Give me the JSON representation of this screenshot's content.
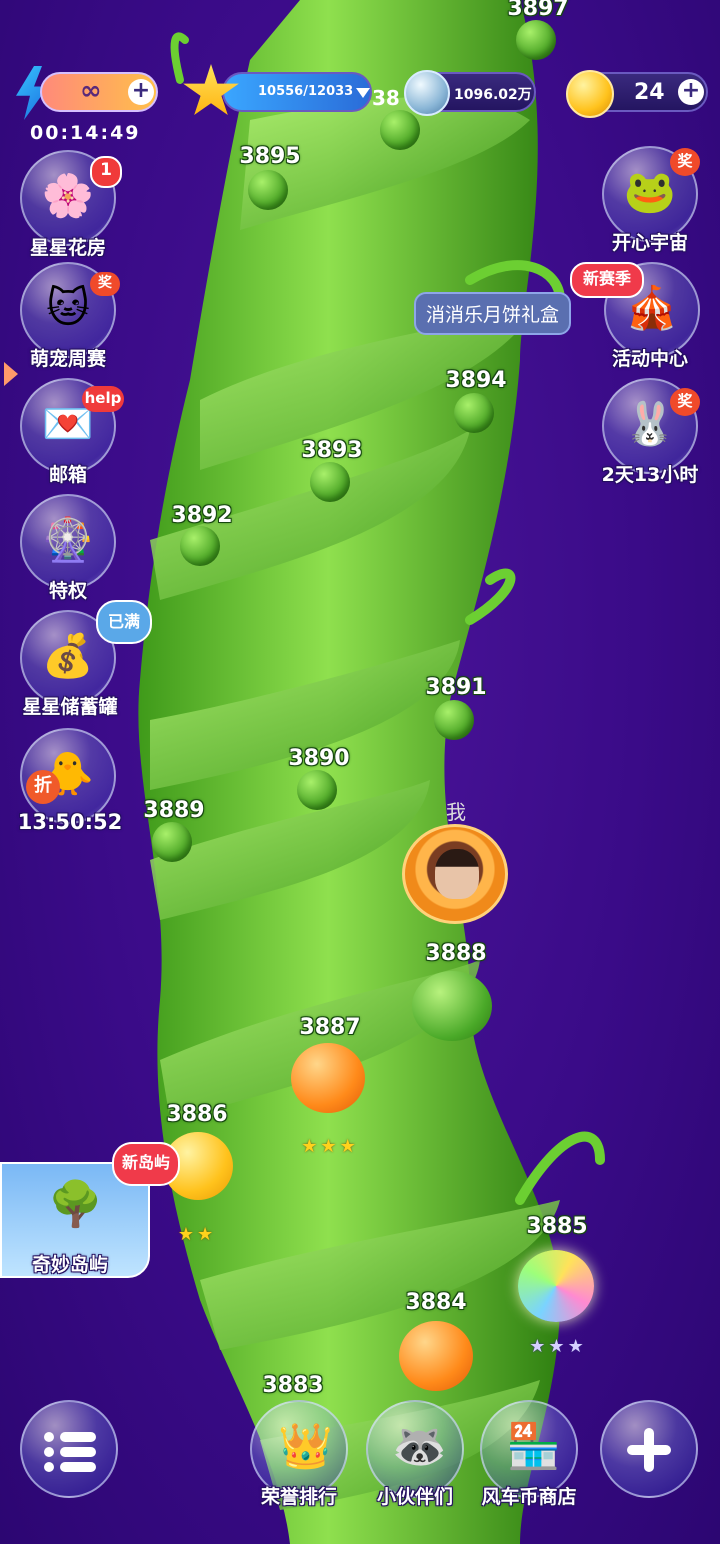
{
  "top_bar": {
    "energy_value": "∞",
    "energy_timer": "00:14:49",
    "stars_progress": "10556/12033",
    "stars_overflow_text": "38",
    "coins_value": "1096.02万",
    "gold_value": "24"
  },
  "side_left": [
    {
      "label": "星星花房",
      "badge": "1",
      "icon": "flower-house-icon"
    },
    {
      "label": "萌宠周赛",
      "badge": "奖",
      "icon": "pet-cat-icon"
    },
    {
      "label": "邮箱",
      "badge": "help",
      "icon": "mail-envelope-icon"
    },
    {
      "label": "特权",
      "badge": "",
      "icon": "privilege-icon"
    },
    {
      "label": "星星储蓄罐",
      "badge": "已满",
      "icon": "piggy-bank-icon"
    },
    {
      "label": "13:50:52",
      "badge": "折",
      "icon": "discount-chick-icon"
    }
  ],
  "side_right": [
    {
      "label": "开心宇宙",
      "badge": "奖",
      "icon": "frog-icon"
    },
    {
      "label": "活动中心",
      "badge": "新赛季",
      "icon": "circus-tent-icon",
      "tooltip": "消消乐月饼礼盒"
    },
    {
      "label": "2天13小时",
      "badge": "奖",
      "icon": "bunny-icon"
    }
  ],
  "levels": [
    {
      "num": "3897"
    },
    {
      "num": "3895"
    },
    {
      "num": "3894"
    },
    {
      "num": "3893"
    },
    {
      "num": "3892"
    },
    {
      "num": "3891"
    },
    {
      "num": "3890"
    },
    {
      "num": "3889"
    },
    {
      "num": "3888"
    },
    {
      "num": "3887",
      "stars": "★★★"
    },
    {
      "num": "3886",
      "stars": "★★"
    },
    {
      "num": "3885",
      "stars": "★★★"
    },
    {
      "num": "3884"
    },
    {
      "num": "3883"
    }
  ],
  "player": {
    "me_label": "我"
  },
  "island": {
    "badge": "新岛屿",
    "label": "奇妙岛屿"
  },
  "bottom_bar": {
    "ranking": "荣誉排行",
    "partners": "小伙伴们",
    "shop": "风车币商店"
  },
  "colors": {
    "background": "#3d0f8c",
    "vine": "#5cc02a",
    "accent_gold": "#ffd21c"
  }
}
